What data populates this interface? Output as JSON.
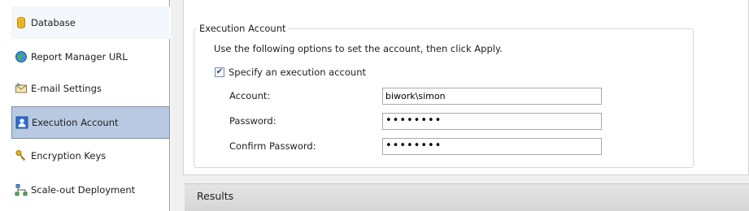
{
  "sidebar": {
    "items": [
      {
        "label": "Database",
        "icon": "database-icon",
        "state": "hover"
      },
      {
        "label": "Report Manager URL",
        "icon": "globe-icon",
        "state": "normal"
      },
      {
        "label": "E-mail Settings",
        "icon": "envelope-icon",
        "state": "normal"
      },
      {
        "label": "Execution Account",
        "icon": "user-account-icon",
        "state": "selected"
      },
      {
        "label": "Encryption Keys",
        "icon": "keys-icon",
        "state": "normal"
      },
      {
        "label": "Scale-out Deployment",
        "icon": "network-icon",
        "state": "normal"
      }
    ]
  },
  "main": {
    "group_title": "Execution Account",
    "instructions": "Use the following options to set the account, then click Apply.",
    "specify_checkbox": {
      "label": "Specify an execution account",
      "checked": true
    },
    "account": {
      "label": "Account:",
      "value": "biwork\\simon"
    },
    "password": {
      "label": "Password:",
      "value": "••••••••"
    },
    "confirm_password": {
      "label": "Confirm Password:",
      "value": "••••••••"
    }
  },
  "results": {
    "title": "Results"
  },
  "colors": {
    "selected_bg": "#b9c9e1",
    "selected_border": "#7d8da8",
    "results_bar": "#dcdcdc"
  }
}
